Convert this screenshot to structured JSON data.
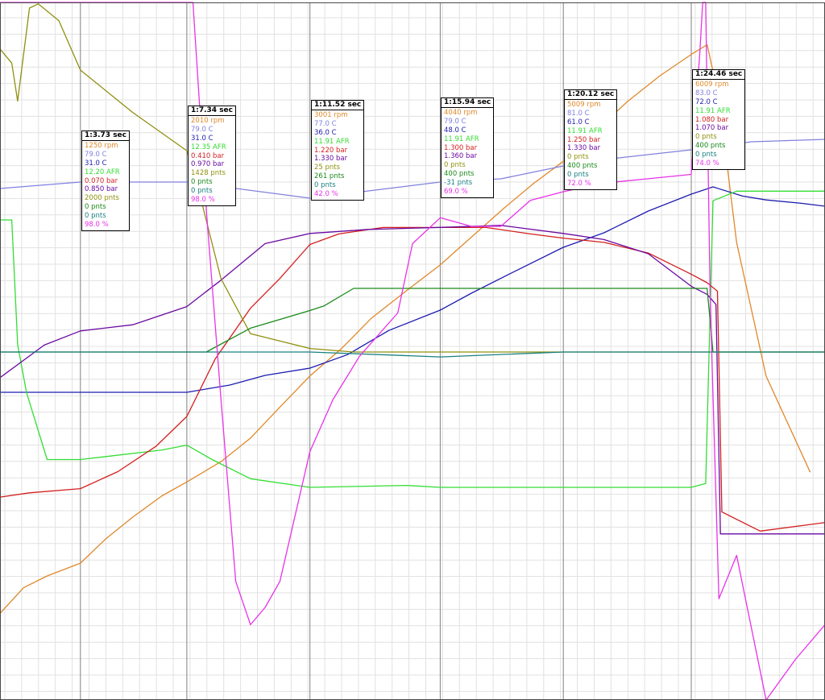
{
  "chart_data": {
    "type": "line",
    "x_range": [
      61.0,
      89.0
    ],
    "grid": true,
    "colors": {
      "background": "#ffffff",
      "grid_minor": "#e1e1e1",
      "grid_major": "#808080",
      "frame": "#4a4a4a"
    },
    "cursor_times": [
      63.73,
      67.34,
      71.52,
      75.94,
      80.12,
      84.46
    ],
    "series": [
      {
        "color": "#e0882a",
        "unit": "rpm",
        "points": [
          [
            61.0,
            780
          ],
          [
            61.8,
            1020
          ],
          [
            62.6,
            1130
          ],
          [
            63.73,
            1250
          ],
          [
            64.6,
            1480
          ],
          [
            65.5,
            1680
          ],
          [
            66.5,
            1880
          ],
          [
            67.34,
            2010
          ],
          [
            68.5,
            2200
          ],
          [
            69.5,
            2420
          ],
          [
            70.5,
            2710
          ],
          [
            71.52,
            3001
          ],
          [
            72.6,
            3260
          ],
          [
            73.6,
            3540
          ],
          [
            74.8,
            3800
          ],
          [
            75.94,
            4040
          ],
          [
            77.0,
            4300
          ],
          [
            78.1,
            4570
          ],
          [
            79.1,
            4800
          ],
          [
            80.12,
            5009
          ],
          [
            81.2,
            5290
          ],
          [
            82.3,
            5570
          ],
          [
            83.4,
            5810
          ],
          [
            84.46,
            6009
          ],
          [
            85.0,
            6100
          ],
          [
            85.4,
            5600
          ],
          [
            86.0,
            4250
          ],
          [
            87.0,
            3000
          ],
          [
            88.5,
            2100
          ]
        ]
      },
      {
        "color": "#8080e0",
        "unit": "C",
        "points": [
          [
            61.0,
            78.2
          ],
          [
            63.73,
            79.0
          ],
          [
            67.34,
            79.0
          ],
          [
            71.52,
            77.0
          ],
          [
            75.94,
            79.0
          ],
          [
            78.0,
            79.4
          ],
          [
            80.12,
            81.0
          ],
          [
            82.0,
            82.0
          ],
          [
            84.46,
            83.0
          ],
          [
            86.5,
            84.0
          ],
          [
            89.0,
            84.3
          ]
        ]
      },
      {
        "color": "#1c1cb0",
        "unit": "C",
        "points": [
          [
            61.0,
            31.0
          ],
          [
            67.34,
            31.0
          ],
          [
            68.8,
            32.5
          ],
          [
            70.0,
            34.5
          ],
          [
            71.52,
            36.0
          ],
          [
            72.8,
            38.8
          ],
          [
            74.2,
            43.8
          ],
          [
            75.94,
            48.0
          ],
          [
            77.0,
            51.5
          ],
          [
            78.2,
            55.2
          ],
          [
            80.12,
            61.0
          ],
          [
            81.5,
            64.0
          ],
          [
            83.0,
            68.5
          ],
          [
            84.46,
            72.0
          ],
          [
            85.2,
            73.5
          ],
          [
            86.2,
            71.6
          ],
          [
            87.0,
            70.8
          ],
          [
            88.2,
            70.1
          ],
          [
            89.0,
            69.5
          ]
        ]
      },
      {
        "color": "#33dd33",
        "unit": "AFR",
        "points": [
          [
            61.0,
            14.7
          ],
          [
            61.4,
            14.7
          ],
          [
            61.6,
            13.4
          ],
          [
            61.9,
            12.9
          ],
          [
            62.6,
            12.2
          ],
          [
            63.73,
            12.2
          ],
          [
            66.5,
            12.3
          ],
          [
            67.34,
            12.35
          ],
          [
            68.2,
            12.2
          ],
          [
            69.5,
            12.0
          ],
          [
            71.52,
            11.91
          ],
          [
            74.8,
            11.93
          ],
          [
            75.94,
            11.91
          ],
          [
            80.12,
            11.91
          ],
          [
            84.46,
            11.91
          ],
          [
            84.95,
            11.95
          ],
          [
            85.2,
            14.9
          ],
          [
            86.0,
            15.0
          ],
          [
            89.0,
            15.0
          ]
        ]
      },
      {
        "color": "#d41e1e",
        "unit": "bar",
        "points": [
          [
            61.0,
            0.03
          ],
          [
            62.0,
            0.05
          ],
          [
            63.73,
            0.07
          ],
          [
            65.0,
            0.15
          ],
          [
            66.3,
            0.27
          ],
          [
            67.34,
            0.41
          ],
          [
            68.3,
            0.68
          ],
          [
            69.5,
            0.92
          ],
          [
            70.5,
            1.06
          ],
          [
            71.52,
            1.22
          ],
          [
            72.5,
            1.27
          ],
          [
            74.0,
            1.3
          ],
          [
            75.94,
            1.3
          ],
          [
            77.5,
            1.3
          ],
          [
            79.0,
            1.27
          ],
          [
            80.12,
            1.25
          ],
          [
            81.5,
            1.23
          ],
          [
            83.0,
            1.18
          ],
          [
            84.46,
            1.08
          ],
          [
            85.0,
            1.04
          ],
          [
            85.35,
            1.0
          ],
          [
            85.5,
            -0.04
          ],
          [
            86.8,
            -0.13
          ],
          [
            89.0,
            -0.09
          ]
        ]
      },
      {
        "color": "#6a0aa0",
        "unit": "bar",
        "points": [
          [
            61.0,
            0.62
          ],
          [
            62.5,
            0.78
          ],
          [
            63.73,
            0.85
          ],
          [
            65.5,
            0.88
          ],
          [
            67.34,
            0.97
          ],
          [
            68.5,
            1.1
          ],
          [
            70.0,
            1.28
          ],
          [
            71.52,
            1.33
          ],
          [
            73.5,
            1.35
          ],
          [
            75.94,
            1.36
          ],
          [
            78.0,
            1.37
          ],
          [
            80.12,
            1.33
          ],
          [
            81.5,
            1.3
          ],
          [
            83.0,
            1.23
          ],
          [
            84.46,
            1.07
          ],
          [
            85.0,
            1.03
          ],
          [
            85.3,
            0.98
          ],
          [
            85.45,
            -0.15
          ],
          [
            89.0,
            -0.15
          ]
        ]
      },
      {
        "color": "#909010",
        "unit": "pnts",
        "points": [
          [
            61.0,
            2150
          ],
          [
            61.4,
            2050
          ],
          [
            61.6,
            1780
          ],
          [
            62.0,
            2440
          ],
          [
            62.3,
            2470
          ],
          [
            63.0,
            2350
          ],
          [
            63.73,
            2000
          ],
          [
            65.5,
            1700
          ],
          [
            67.34,
            1428
          ],
          [
            67.8,
            1100
          ],
          [
            68.5,
            520
          ],
          [
            69.5,
            130
          ],
          [
            71.52,
            25
          ],
          [
            73.0,
            0
          ],
          [
            89.0,
            0
          ]
        ]
      },
      {
        "color": "#1a8a1a",
        "unit": "pnts",
        "points": [
          [
            61.0,
            0
          ],
          [
            68.0,
            0
          ],
          [
            69.5,
            150
          ],
          [
            71.52,
            261
          ],
          [
            72.0,
            290
          ],
          [
            73.0,
            400
          ],
          [
            75.94,
            400
          ],
          [
            80.12,
            400
          ],
          [
            84.46,
            400
          ],
          [
            85.0,
            400
          ],
          [
            85.2,
            0
          ],
          [
            89.0,
            0
          ]
        ]
      },
      {
        "color": "#1a8080",
        "unit": "pnts",
        "points": [
          [
            61.0,
            0
          ],
          [
            67.34,
            0
          ],
          [
            71.52,
            0
          ],
          [
            75.94,
            -31
          ],
          [
            80.12,
            0
          ],
          [
            84.46,
            0
          ],
          [
            89.0,
            0
          ]
        ]
      },
      {
        "color": "#e832e8",
        "unit": "%",
        "points": [
          [
            61.0,
            98.0
          ],
          [
            63.73,
            98.0
          ],
          [
            67.34,
            98.0
          ],
          [
            67.55,
            98.0
          ],
          [
            68.0,
            70.0
          ],
          [
            68.5,
            48.0
          ],
          [
            69.0,
            27.0
          ],
          [
            69.5,
            22.0
          ],
          [
            70.0,
            24.0
          ],
          [
            70.5,
            27.0
          ],
          [
            71.52,
            42.0
          ],
          [
            72.3,
            48.0
          ],
          [
            73.2,
            53.0
          ],
          [
            74.5,
            58.0
          ],
          [
            75.0,
            66.0
          ],
          [
            75.94,
            69.0
          ],
          [
            77.0,
            68.0
          ],
          [
            78.0,
            68.0
          ],
          [
            79.0,
            71.0
          ],
          [
            80.12,
            72.0
          ],
          [
            81.5,
            73.0
          ],
          [
            83.0,
            73.5
          ],
          [
            84.46,
            74.0
          ],
          [
            84.75,
            88.0
          ],
          [
            84.85,
            99.0
          ],
          [
            84.95,
            97.0
          ],
          [
            85.1,
            60.0
          ],
          [
            85.4,
            25.0
          ],
          [
            86.0,
            30.0
          ],
          [
            87.0,
            10.0
          ],
          [
            88.0,
            18.0
          ],
          [
            89.0,
            22.0
          ]
        ]
      }
    ],
    "cursor_readouts": [
      {
        "time": "1:3.73 sec",
        "values": [
          "1250 rpm",
          "79.0 C",
          "31.0 C",
          "12.20 AFR",
          "0.070 bar",
          "0.850 bar",
          "2000 pnts",
          "0 pnts",
          "0 pnts",
          "98.0 %"
        ]
      },
      {
        "time": "1:7.34 sec",
        "values": [
          "2010 rpm",
          "79.0 C",
          "31.0 C",
          "12.35 AFR",
          "0.410 bar",
          "0.970 bar",
          "1428 pnts",
          "0 pnts",
          "0 pnts",
          "98.0 %"
        ]
      },
      {
        "time": "1:11.52 sec",
        "values": [
          "3001 rpm",
          "77.0 C",
          "36.0 C",
          "11.91 AFR",
          "1.220 bar",
          "1.330 bar",
          "25 pnts",
          "261 pnts",
          "0 pnts",
          "42.0 %"
        ]
      },
      {
        "time": "1:15.94 sec",
        "values": [
          "4040 rpm",
          "79.0 C",
          "48.0 C",
          "11.91 AFR",
          "1.300 bar",
          "1.360 bar",
          "0 pnts",
          "400 pnts",
          "-31 pnts",
          "69.0 %"
        ]
      },
      {
        "time": "1:20.12 sec",
        "values": [
          "5009 rpm",
          "81.0 C",
          "61.0 C",
          "11.91 AFR",
          "1.250 bar",
          "1.330 bar",
          "0 pnts",
          "400 pnts",
          "0 pnts",
          "72.0 %"
        ]
      },
      {
        "time": "1:24.46 sec",
        "values": [
          "6009 rpm",
          "83.0 C",
          "72.0 C",
          "11.91 AFR",
          "1.080 bar",
          "1.070 bar",
          "0 pnts",
          "400 pnts",
          "0 pnts",
          "74.0 %"
        ]
      }
    ]
  }
}
